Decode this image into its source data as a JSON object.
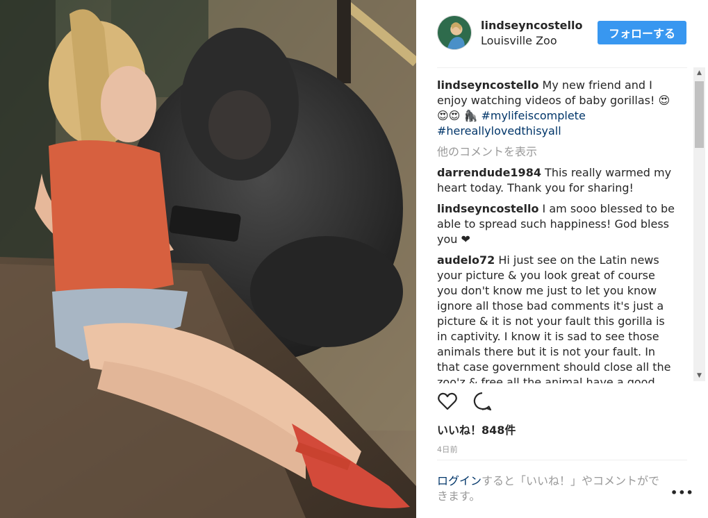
{
  "post": {
    "username": "lindseyncostello",
    "location": "Louisville Zoo",
    "follow_label": "フォローする",
    "caption": {
      "user": "lindseyncostello",
      "text": " My new friend and I enjoy watching videos of baby gorillas! 😍😍😍 🦍 ",
      "hashtags": [
        "#mylifeiscomplete",
        "#hereallylovedthisyall"
      ]
    },
    "load_more_label": "他のコメントを表示",
    "comments": [
      {
        "user": "darrendude1984",
        "text": " This really warmed my heart today. Thank you for sharing!"
      },
      {
        "user": "lindseyncostello",
        "text": " I am sooo blessed to be able to spread such happiness! God bless you ❤"
      },
      {
        "user": "audelo72",
        "text": " Hi just see on the Latin news your picture & you look great of course you don't know me just to let you know ignore all those bad comments it's just a picture & it is not your fault this gorilla is in captivity. I know it is sad to see those animals there but it is not your fault. In that case government should close all the zoo'z & free all the animal have a good day🙂 /"
      }
    ],
    "likes_label": "いいね！848件",
    "time_label": "4日前",
    "login_link": "ログイン",
    "login_rest": "すると「いいね！」やコメントができます。",
    "more_label": "•••"
  },
  "icons": {
    "like": "heart-outline-icon",
    "comment": "speech-bubble-icon",
    "more": "more-options-icon"
  },
  "colors": {
    "follow_button": "#3897f0",
    "hashtag": "#003569",
    "muted": "#999999"
  }
}
